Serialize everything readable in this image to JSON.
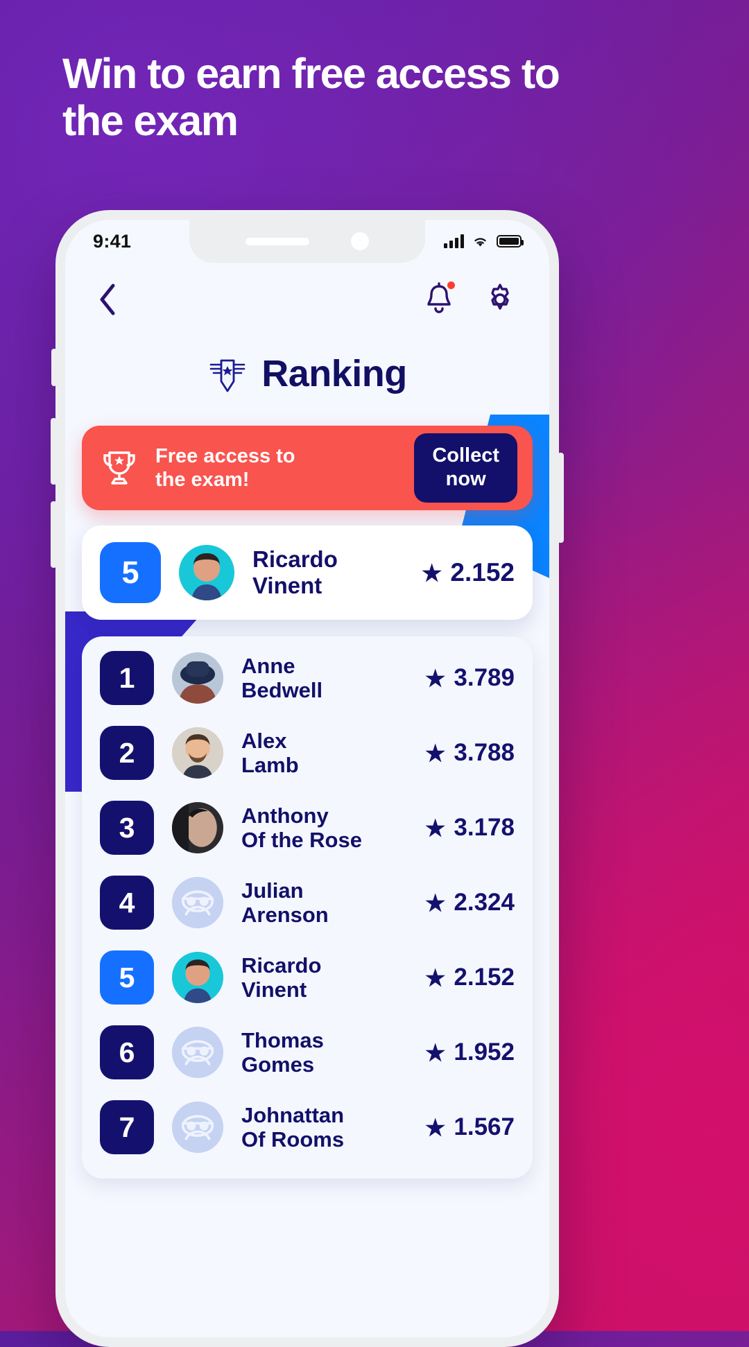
{
  "promo": {
    "headline": "Win to earn free access to the exam"
  },
  "phone": {
    "status": {
      "time": "9:41",
      "signal_icon": "cellular-signal-icon",
      "wifi_icon": "wifi-icon",
      "battery_icon": "battery-full-icon"
    },
    "nav": {
      "back_icon": "chevron-left-icon",
      "bell_icon": "notification-bell-icon",
      "settings_icon": "gear-icon",
      "badge": ""
    },
    "header": {
      "title": "Ranking",
      "logo_icon": "winged-shield-badge-icon"
    },
    "banner": {
      "trophy_icon": "trophy-icon",
      "text_line1": "Free access to",
      "text_line2": "the exam!",
      "cta_line1": "Collect",
      "cta_line2": "now"
    },
    "self": {
      "rank": "5",
      "first_name": "Ricardo",
      "last_name": "Vinent",
      "score": "2.152",
      "star_icon": "star-icon"
    },
    "list": [
      {
        "rank": "1",
        "first_name": "Anne",
        "last_name": "Bedwell",
        "score": "3.789",
        "avatar": "photo-hat-woman"
      },
      {
        "rank": "2",
        "first_name": "Alex",
        "last_name": "Lamb",
        "score": "3.788",
        "avatar": "photo-bearded-man"
      },
      {
        "rank": "3",
        "first_name": "Anthony",
        "last_name": "Of the Rose",
        "score": "3.178",
        "avatar": "photo-dark-portrait"
      },
      {
        "rank": "4",
        "first_name": "Julian",
        "last_name": "Arenson",
        "score": "2.324",
        "avatar": "placeholder-avatar-icon"
      },
      {
        "rank": "5",
        "first_name": "Ricardo",
        "last_name": "Vinent",
        "score": "2.152",
        "avatar": "photo-teal-man"
      },
      {
        "rank": "6",
        "first_name": "Thomas",
        "last_name": "Gomes",
        "score": "1.952",
        "avatar": "placeholder-avatar-icon"
      },
      {
        "rank": "7",
        "first_name": "Johnattan",
        "last_name": "Of Rooms",
        "score": "1.567",
        "avatar": "placeholder-avatar-icon"
      }
    ]
  },
  "colors": {
    "accent_red": "#f9544e",
    "navy": "#14116e",
    "blue": "#1570ff",
    "indigo": "#3728c9",
    "sky": "#0a84ff"
  }
}
